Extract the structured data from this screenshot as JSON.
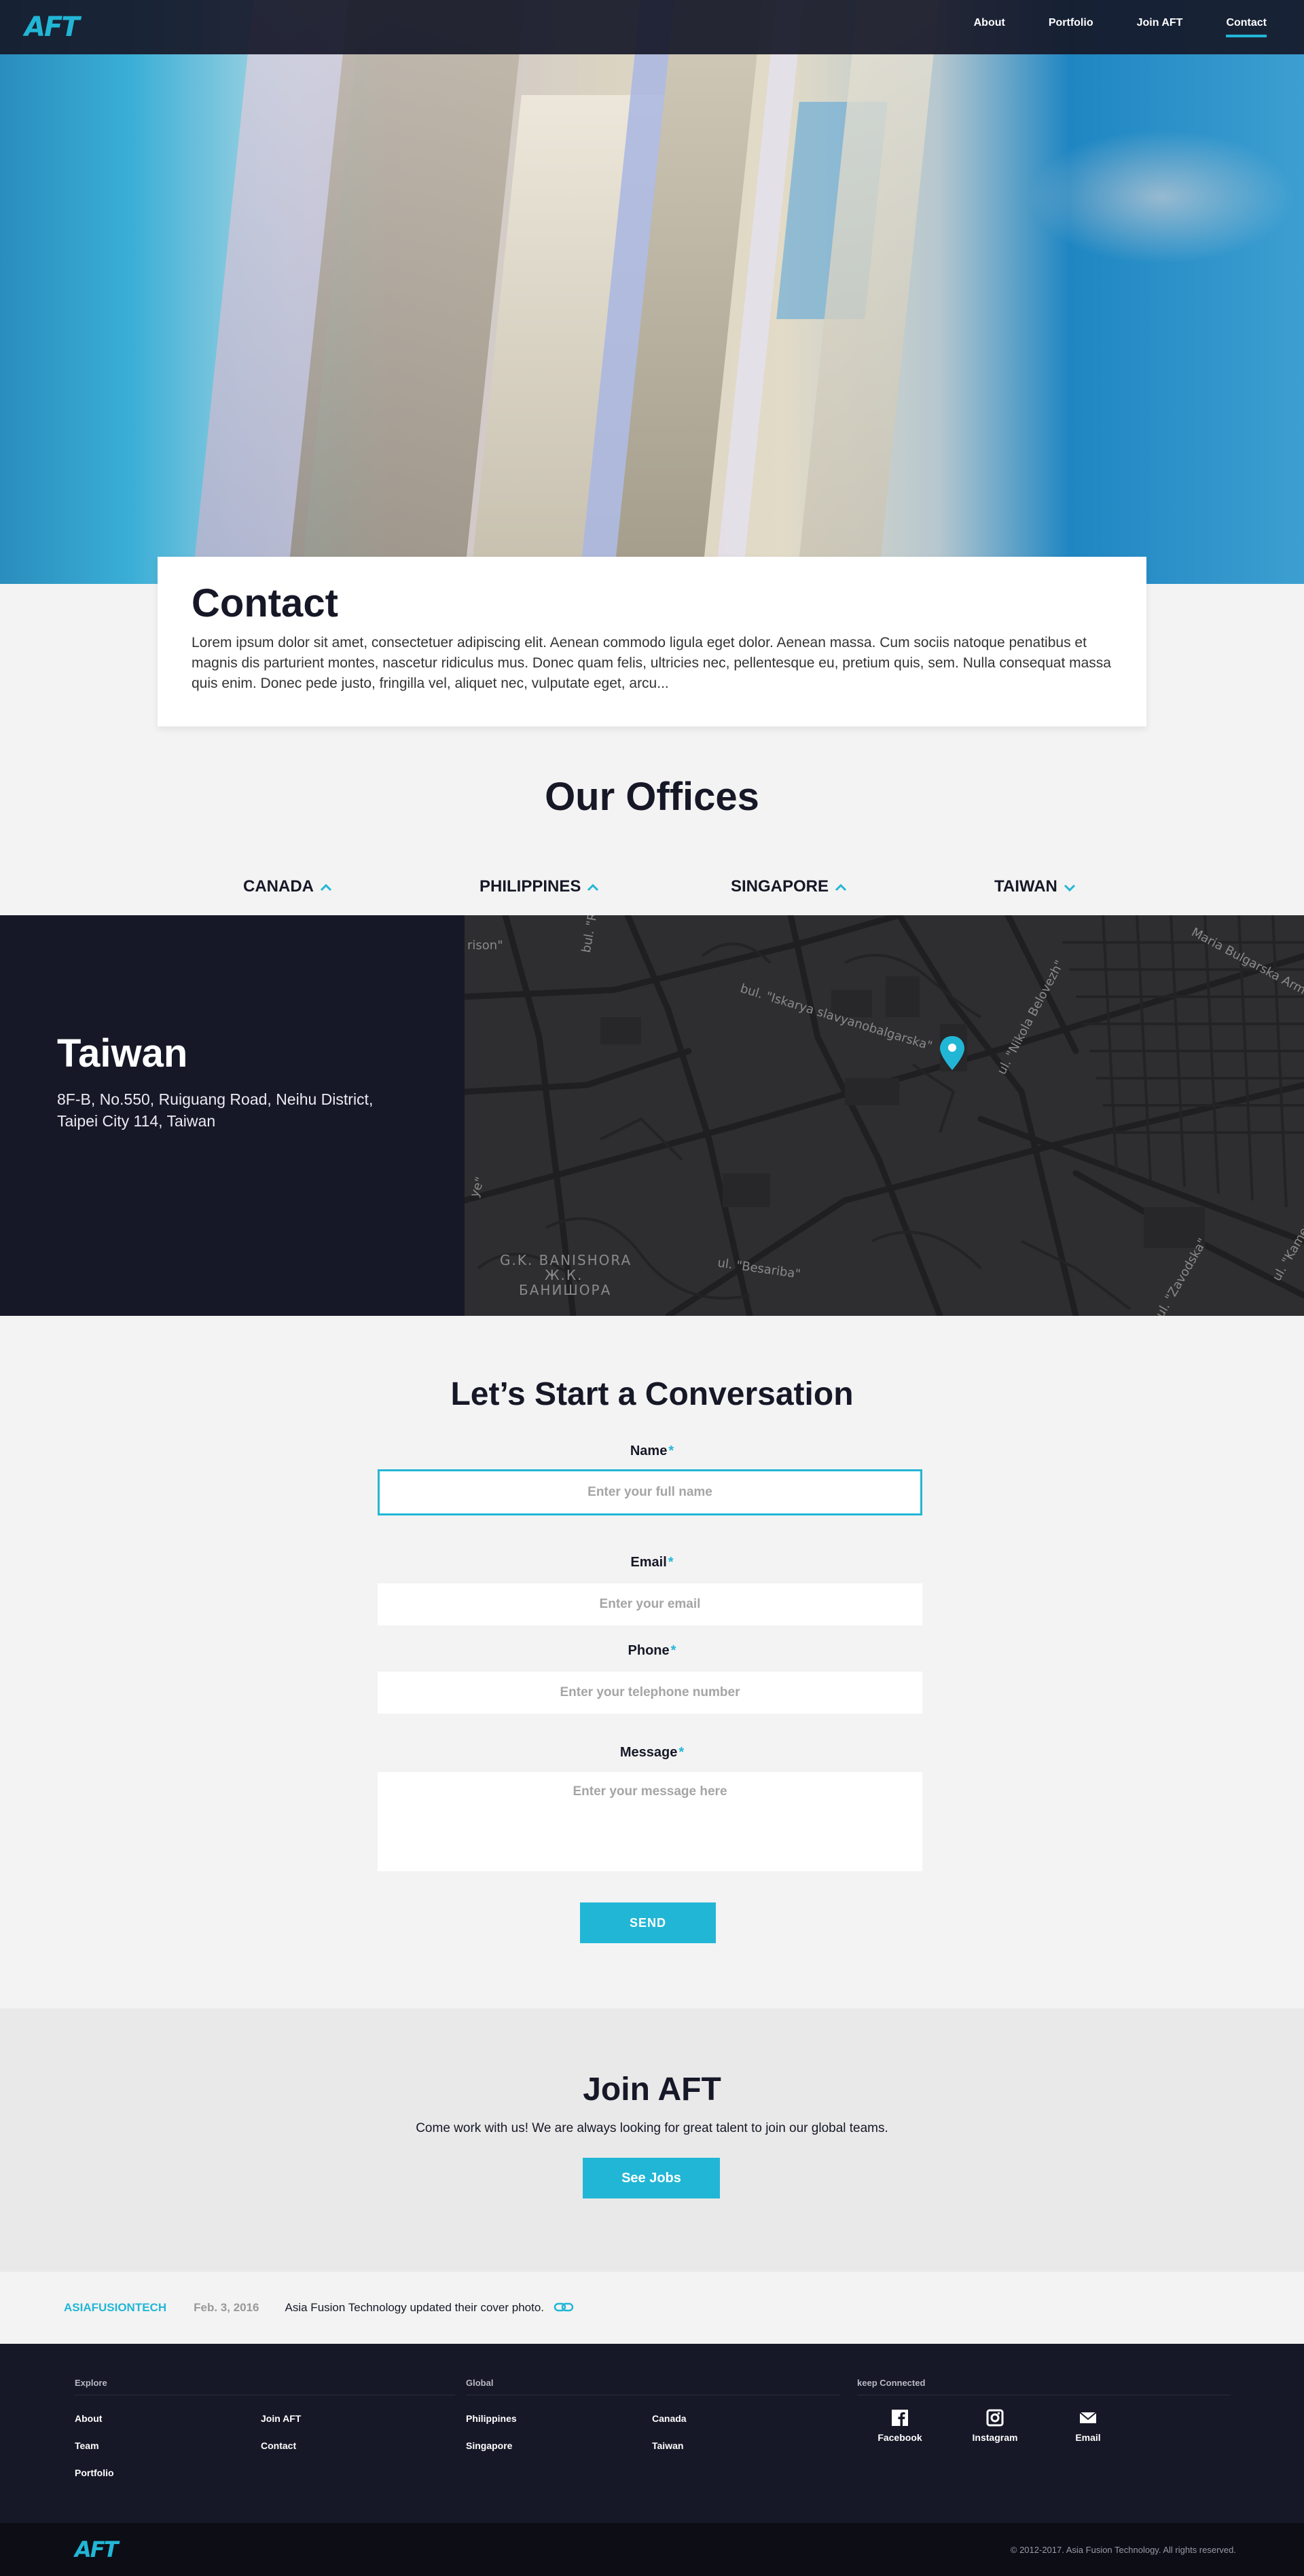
{
  "header": {
    "logo": "AFT",
    "nav": [
      {
        "label": "About",
        "active": false
      },
      {
        "label": "Portfolio",
        "active": false
      },
      {
        "label": "Join AFT",
        "active": false
      },
      {
        "label": "Contact",
        "active": true
      }
    ]
  },
  "contact": {
    "title": "Contact",
    "body": "Lorem ipsum dolor sit amet, consectetuer adipiscing elit. Aenean commodo ligula eget dolor. Aenean massa. Cum sociis natoque penatibus et magnis dis parturient montes, nascetur ridiculus mus. Donec quam felis, ultricies nec, pellentesque eu, pretium quis, sem. Nulla consequat massa quis enim. Donec pede justo, fringilla vel, aliquet nec, vulputate eget, arcu..."
  },
  "offices": {
    "title": "Our Offices",
    "tabs": [
      {
        "label": "CANADA",
        "expanded": false
      },
      {
        "label": "PHILIPPINES",
        "expanded": false
      },
      {
        "label": "SINGAPORE",
        "expanded": false
      },
      {
        "label": "TAIWAN",
        "expanded": true
      }
    ],
    "selected": {
      "name": "Taiwan",
      "address_line1": "8F-B, No.550, Ruiguang Road, Neihu District,",
      "address_line2": "Taipei City 114, Taiwan"
    },
    "map_labels": [
      "bul. \"Ro",
      "bul. \"Iskarya slavyanobalgarska\"",
      "ul. \"Nikola Belovezh\"",
      "Maria Bulgarska Arma",
      "G.K. BANISHORA",
      "Ж.К.",
      "БАНИШОРА",
      "ul. \"Besariba\"",
      "ul. \"Zavodska\"",
      "ul. \"Kamen",
      "rison\"",
      "ye\""
    ]
  },
  "form": {
    "title": "Let’s Start a Conversation",
    "required_mark": "*",
    "name": {
      "label": "Name",
      "placeholder": "Enter your full name",
      "value": ""
    },
    "email": {
      "label": "Email",
      "placeholder": "Enter your email",
      "value": ""
    },
    "phone": {
      "label": "Phone",
      "placeholder": "Enter your telephone number",
      "value": ""
    },
    "message": {
      "label": "Message",
      "placeholder": "Enter your message here",
      "value": ""
    },
    "submit": "SEND"
  },
  "join": {
    "title": "Join AFT",
    "text": "Come work with us! We are always looking for great talent to join our global teams.",
    "button": "See Jobs"
  },
  "social_feed": {
    "handle": "ASIAFUSIONTECH",
    "date": "Feb. 3, 2016",
    "post": "Asia Fusion Technology updated their cover photo."
  },
  "footer": {
    "explore_heading": "Explore",
    "explore": [
      "About",
      "Join AFT",
      "Team",
      "Contact",
      "Portfolio"
    ],
    "global_heading": "Global",
    "global": [
      "Philippines",
      "Canada",
      "Singapore",
      "Taiwan"
    ],
    "connect_heading": "keep Connected",
    "social": [
      {
        "label": "Facebook",
        "icon": "facebook-icon"
      },
      {
        "label": "Instagram",
        "icon": "instagram-icon"
      },
      {
        "label": "Email",
        "icon": "mail-icon"
      }
    ],
    "logo": "AFT",
    "copyright": "© 2012-2017. Asia Fusion Technology. All rights reserved."
  },
  "colors": {
    "accent": "#22b6d6",
    "navy": "#161827",
    "page_bg": "#f3f3f3"
  }
}
